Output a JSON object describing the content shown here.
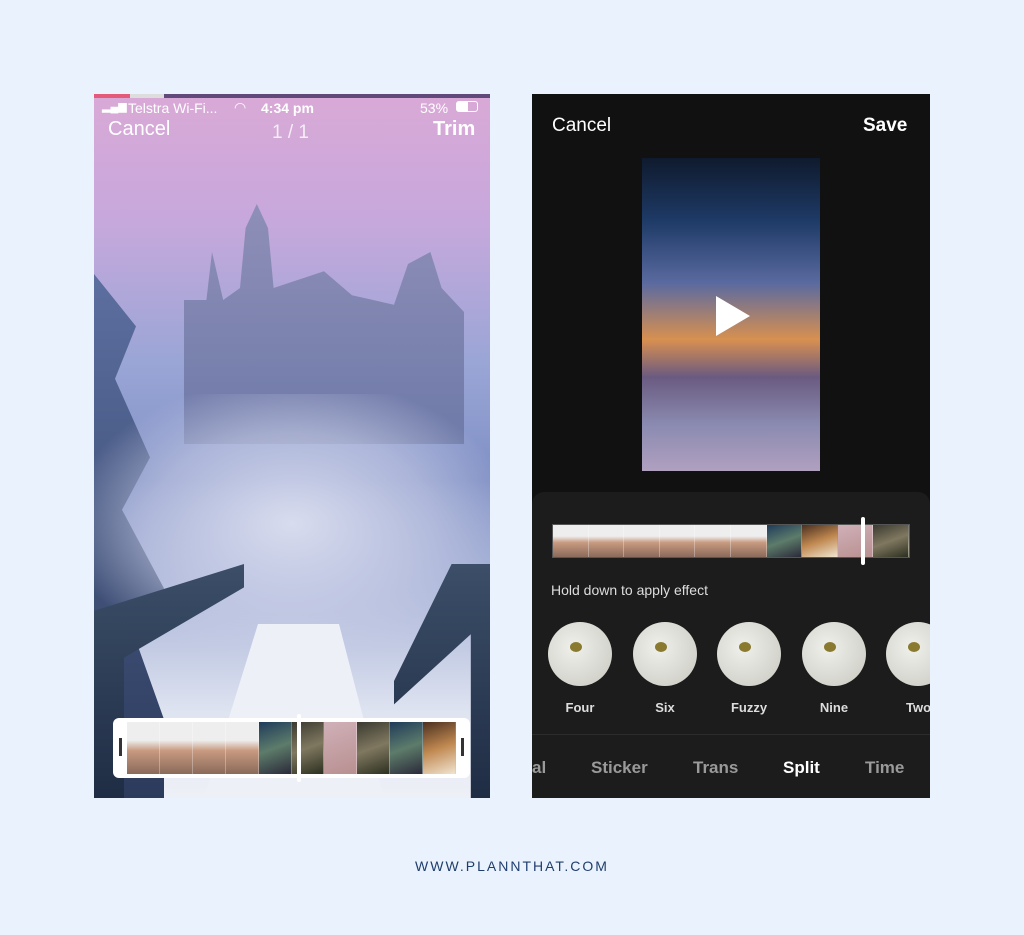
{
  "left_screen": {
    "status": {
      "carrier": "Telstra Wi-Fi...",
      "time": "4:34 pm",
      "battery": "53%"
    },
    "cancel": "Cancel",
    "counter": "1 / 1",
    "trim": "Trim"
  },
  "right_screen": {
    "cancel": "Cancel",
    "save": "Save",
    "hint": "Hold down to apply effect",
    "effects": [
      {
        "label": "Four"
      },
      {
        "label": "Six"
      },
      {
        "label": "Fuzzy"
      },
      {
        "label": "Nine"
      },
      {
        "label": "Two"
      }
    ],
    "tabs": [
      {
        "label": "al"
      },
      {
        "label": "Sticker"
      },
      {
        "label": "Trans"
      },
      {
        "label": "Split",
        "active": true
      },
      {
        "label": "Time"
      }
    ]
  },
  "footer": "WWW.PLANNTHAT.COM"
}
